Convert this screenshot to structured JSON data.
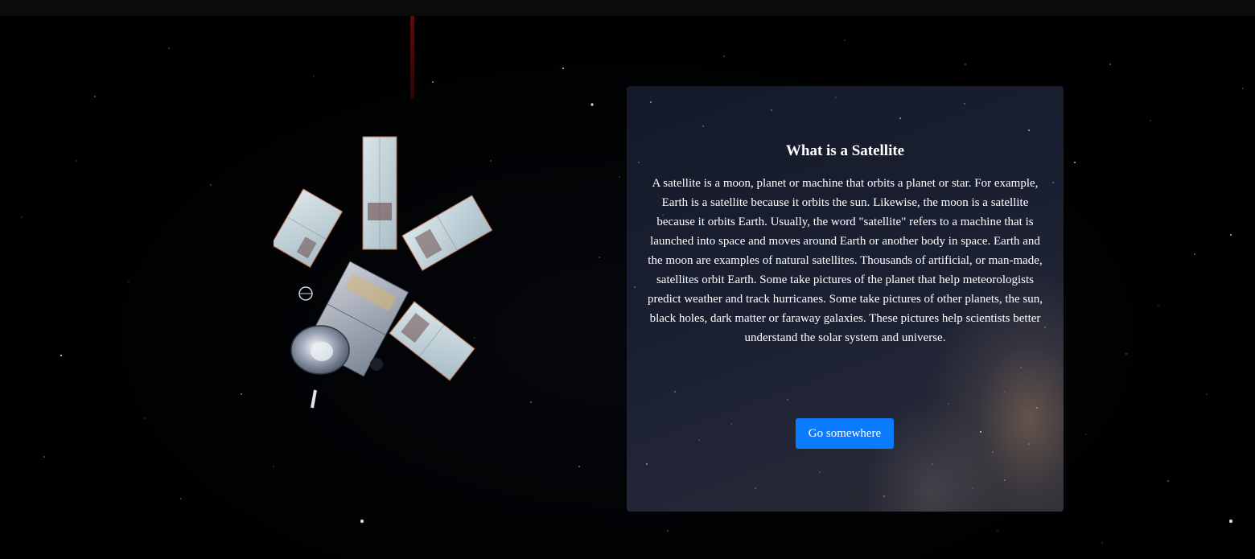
{
  "card": {
    "title": "What is a Satellite",
    "body": "A satellite is a moon, planet or machine that orbits a planet or star. For example, Earth is a satellite because it orbits the sun. Likewise, the moon is a satellite because it orbits Earth. Usually, the word \"satellite\" refers to a machine that is launched into space and moves around Earth or another body in space. Earth and the moon are examples of natural satellites. Thousands of artificial, or man-made, satellites orbit Earth. Some take pictures of the planet that help meteorologists predict weather and track hurricanes. Some take pictures of other planets, the sun, black holes, dark matter or faraway galaxies. These pictures help scientists better understand the solar system and universe.",
    "button_label": "Go somewhere"
  },
  "colors": {
    "background": "#000000",
    "button": "#0a7cff",
    "text": "#ffffff"
  }
}
